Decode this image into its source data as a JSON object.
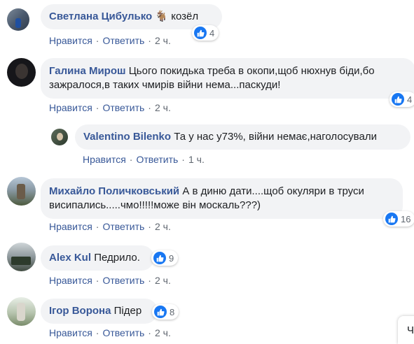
{
  "actions": {
    "like": "Нравится",
    "reply": "Ответить"
  },
  "comments": [
    {
      "author": "Светлана Цибулько",
      "emoji": "🐐",
      "text": "козёл",
      "reactions": "4",
      "time": "2 ч."
    },
    {
      "author": "Галина Мирош",
      "text_line1": "Цього покидька треба в окопи,щоб нюхнув біди,бо",
      "text_line2": "зажралося,в таких чмирів війни нема...паскуди!",
      "reactions": "4",
      "time": "2 ч."
    },
    {
      "author": "Valentino Bilenko",
      "text": "Та у нас у73%, війни немає,наголосували",
      "time": "1 ч."
    },
    {
      "author": "Михайло Поличковський",
      "text_line1": "А в диню дати....щоб окуляри в труси",
      "text_line2": "висипались.....чмо!!!!!може він москаль???)",
      "reactions": "16",
      "time": "2 ч."
    },
    {
      "author": "Alex Kul",
      "text": "Педрило.",
      "reactions": "9",
      "time": "2 ч."
    },
    {
      "author": "Ігор Ворона",
      "text": "Підер",
      "reactions": "8",
      "time": "2 ч."
    }
  ],
  "corner_button": {
    "label": "Ч"
  },
  "colors": {
    "author": "#385898",
    "bubble": "#f2f3f5",
    "like": "#1877f2"
  }
}
